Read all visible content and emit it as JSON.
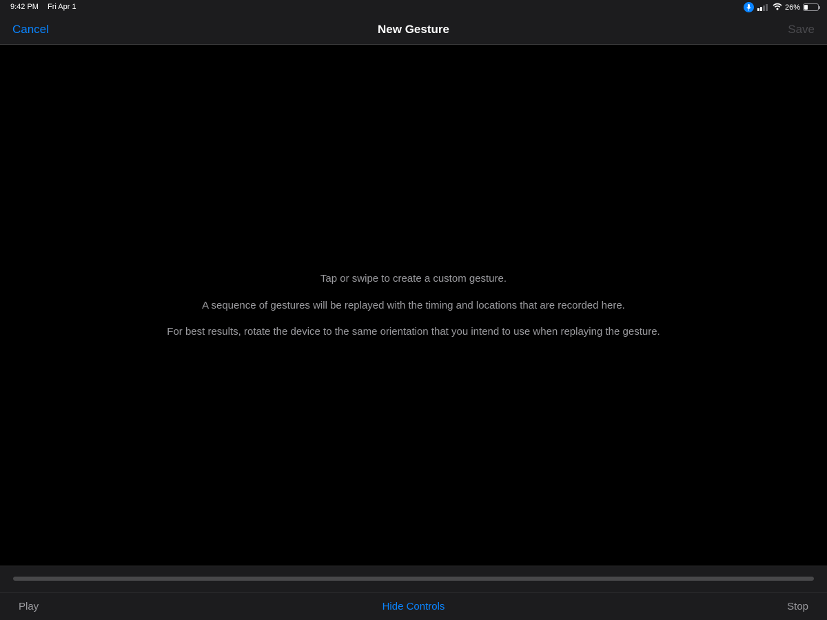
{
  "status_bar": {
    "time": "9:42 PM",
    "date": "Fri Apr 1",
    "battery_percent": "26%",
    "battery_level": 0.26,
    "icons": [
      "mic-icon",
      "cellular-signal-icon",
      "wifi-icon",
      "battery-icon"
    ]
  },
  "nav": {
    "cancel_label": "Cancel",
    "title": "New Gesture",
    "save_label": "Save"
  },
  "instructions": [
    "Tap or swipe to create a custom gesture.",
    "A sequence of gestures will be replayed with the timing and locations that are recorded here.",
    "For best results, rotate the device to the same orientation that you intend to use when replaying the gesture."
  ],
  "toolbar": {
    "play_label": "Play",
    "hide_controls_label": "Hide Controls",
    "stop_label": "Stop"
  },
  "colors": {
    "accent": "#0a84ff",
    "bar_background": "#1c1c1e",
    "canvas_background": "#000000",
    "secondary_text": "#9a9a9e",
    "disabled_text": "#4a4a4e"
  }
}
